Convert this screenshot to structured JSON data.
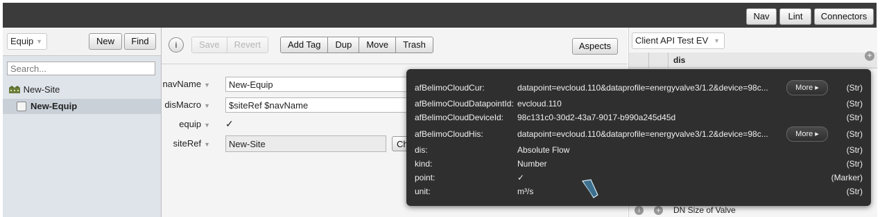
{
  "topbar": {
    "nav": "Nav",
    "lint": "Lint",
    "connectors": "Connectors"
  },
  "left": {
    "type_select": "Equip",
    "new_label": "New",
    "find_label": "Find",
    "search_placeholder": "Search...",
    "tree": {
      "site": "New-Site",
      "equip": "New-Equip"
    }
  },
  "toolbar": {
    "save": "Save",
    "revert": "Revert",
    "add_tag": "Add Tag",
    "dup": "Dup",
    "move": "Move",
    "trash": "Trash",
    "aspects": "Aspects"
  },
  "form": {
    "fields": [
      {
        "label": "navName",
        "value": "New-Equip"
      },
      {
        "label": "disMacro",
        "value": "$siteRef $navName"
      },
      {
        "label": "equip",
        "value": "✓"
      },
      {
        "label": "siteRef",
        "value": "New-Site"
      }
    ],
    "siteref_button": "Ch"
  },
  "right": {
    "select": "Client API Test EV",
    "column_header": "dis",
    "bottom_row": "DN Size of Valve"
  },
  "popup": {
    "rows": [
      {
        "name": "afBelimoCloudCur:",
        "value": "datapoint=evcloud.110&dataprofile=energyvalve3/1.2&device=98c...",
        "kind": "(Str)",
        "more": "More ▸"
      },
      {
        "name": "afBelimoCloudDatapointId:",
        "value": "evcloud.110",
        "kind": "(Str)"
      },
      {
        "name": "afBelimoCloudDeviceId:",
        "value": "98c131c0-30d2-43a7-9017-b990a245d45d",
        "kind": "(Str)"
      },
      {
        "name": "afBelimoCloudHis:",
        "value": "datapoint=evcloud.110&dataprofile=energyvalve3/1.2&device=98c...",
        "kind": "(Str)",
        "more": "More ▸"
      },
      {
        "name": "dis:",
        "value": "Absolute Flow",
        "kind": "(Str)"
      },
      {
        "name": "kind:",
        "value": "Number",
        "kind": "(Str)"
      },
      {
        "name": "point:",
        "value": "✓",
        "kind": "(Marker)"
      },
      {
        "name": "unit:",
        "value": "m³/s",
        "kind": "(Str)"
      }
    ]
  },
  "colors": {
    "topbar": "#3b3b3b",
    "popup_bg": "#262626",
    "tree_selected": "#c9d0d8"
  }
}
